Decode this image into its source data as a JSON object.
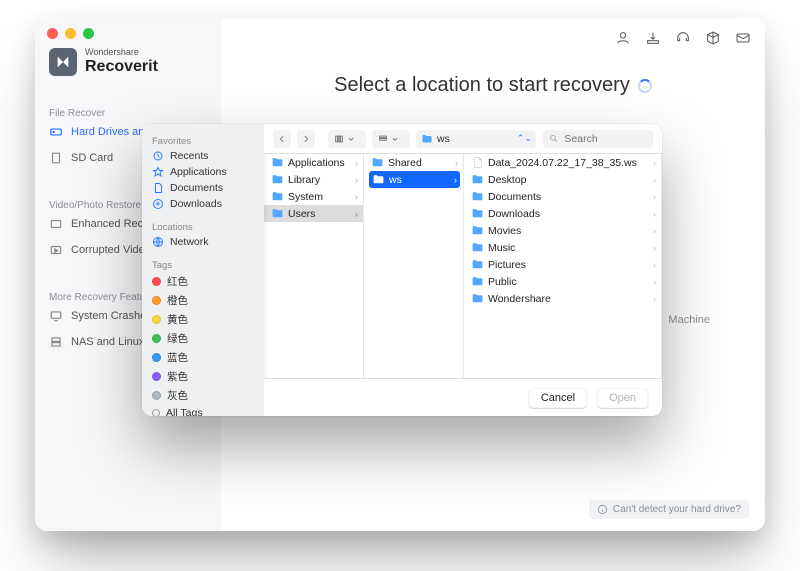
{
  "app": {
    "brand_sub": "Wondershare",
    "brand_main": "Recoverit",
    "heading": "Select a location to start recovery",
    "sections": {
      "file_recover": "File Recover",
      "video_restore": "Video/Photo Restore",
      "more_features": "More Recovery Features"
    },
    "nav": {
      "hard_drives": "Hard Drives and",
      "sd_card": "SD Card",
      "enhanced": "Enhanced Recov",
      "corrupted": "Corrupted Video",
      "system_crash": "System Crashed",
      "nas_linux": "NAS and Linux"
    },
    "bg_snippet": "Machine",
    "detect_text": "Can't detect your hard drive?"
  },
  "dialog": {
    "sidebar_groups": {
      "favorites": "Favorites",
      "locations": "Locations",
      "tags": "Tags"
    },
    "favorites": {
      "recents": "Recents",
      "applications": "Applications",
      "documents": "Documents",
      "downloads": "Downloads"
    },
    "locations": {
      "network": "Network"
    },
    "tags": {
      "red": "红色",
      "orange": "橙色",
      "yellow": "黄色",
      "green": "绿色",
      "blue": "蓝色",
      "purple": "紫色",
      "gray": "灰色",
      "all_tags": "All Tags"
    },
    "tag_colors": {
      "red": "#ff4d4f",
      "orange": "#ff9a2e",
      "yellow": "#ffd43b",
      "green": "#40c057",
      "blue": "#339af0",
      "purple": "#845ef7",
      "gray": "#adb5bd"
    },
    "path_current": "ws",
    "search_placeholder": "Search",
    "columns": {
      "c1": [
        {
          "name": "Applications",
          "selected": false
        },
        {
          "name": "Library",
          "selected": false
        },
        {
          "name": "System",
          "selected": false
        },
        {
          "name": "Users",
          "selected": true
        }
      ],
      "c2": [
        {
          "name": "Shared",
          "selected": false
        },
        {
          "name": "ws",
          "selected": true,
          "blue": true
        }
      ],
      "c3": [
        {
          "name": "Data_2024.07.22_17_38_35.ws",
          "type": "file"
        },
        {
          "name": "Desktop"
        },
        {
          "name": "Documents"
        },
        {
          "name": "Downloads"
        },
        {
          "name": "Movies"
        },
        {
          "name": "Music"
        },
        {
          "name": "Pictures"
        },
        {
          "name": "Public"
        },
        {
          "name": "Wondershare"
        }
      ]
    },
    "buttons": {
      "cancel": "Cancel",
      "open": "Open"
    }
  }
}
